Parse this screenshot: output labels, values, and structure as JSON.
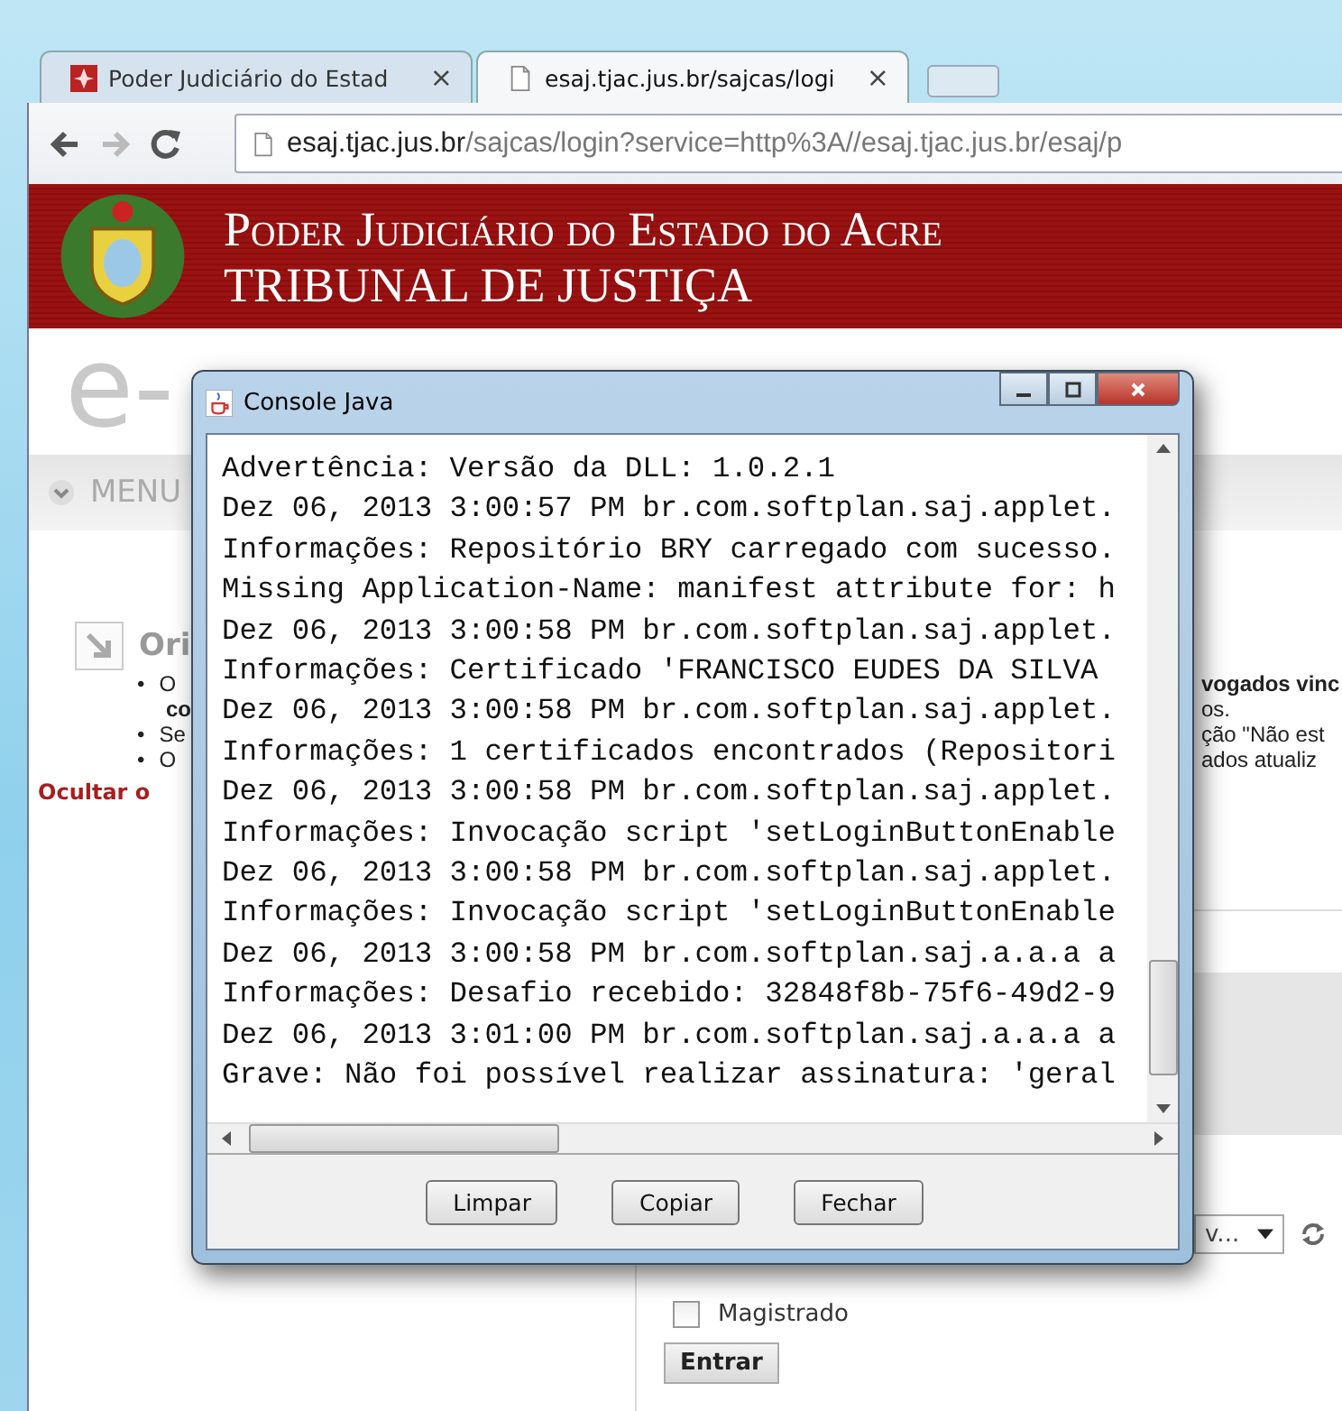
{
  "browser": {
    "tabs": [
      {
        "title": "Poder Judiciário do Estad",
        "close": "×",
        "selected": false
      },
      {
        "title": "esaj.tjac.jus.br/sajcas/logi",
        "close": "×",
        "selected": true
      }
    ],
    "address": {
      "host": "esaj.tjac.jus.br",
      "path": "/sajcas/login?service=http%3A//esaj.tjac.jus.br/esaj/p"
    }
  },
  "page": {
    "banner": {
      "line_1": "Poder Judiciário do Estado do Acre",
      "line_2": "TRIBUNAL DE JUSTIÇA"
    },
    "logo": "e-",
    "menu": "MENU",
    "info": {
      "heading": "Ori",
      "bullets": [
        {
          "bullet": "•",
          "left": "O",
          "right": "vogados vinc"
        },
        {
          "left": "**co**",
          "right": "os."
        },
        {
          "bullet": "•",
          "left": "Se",
          "right": "ção \"Não est"
        },
        {
          "bullet": "•",
          "left": "O",
          "right": "ados atualiz"
        }
      ],
      "hide_link": "Ocultar o"
    },
    "login": {
      "select_value": "v...",
      "checkbox": {
        "label": "Magistrado",
        "checked": false
      },
      "submit": "Entrar"
    }
  },
  "console": {
    "title": "Console Java",
    "lines": [
      "Advertência: Versão da DLL: 1.0.2.1",
      "Dez 06, 2013 3:00:57 PM br.com.softplan.saj.applet.",
      "Informações: Repositório BRY carregado com sucesso.",
      "Missing Application-Name: manifest attribute for: h",
      "Dez 06, 2013 3:00:58 PM br.com.softplan.saj.applet.",
      "Informações: Certificado 'FRANCISCO EUDES DA SILVA",
      "Dez 06, 2013 3:00:58 PM br.com.softplan.saj.applet.",
      "Informações: 1 certificados encontrados (Repositori",
      "Dez 06, 2013 3:00:58 PM br.com.softplan.saj.applet.",
      "Informações: Invocação script 'setLoginButtonEnable",
      "Dez 06, 2013 3:00:58 PM br.com.softplan.saj.applet.",
      "Informações: Invocação script 'setLoginButtonEnable",
      "Dez 06, 2013 3:00:58 PM br.com.softplan.saj.a.a.a a",
      "Informações: Desafio recebido: 32848f8b-75f6-49d2-9",
      "Dez 06, 2013 3:01:00 PM br.com.softplan.saj.a.a.a a",
      "Grave: Não foi possível realizar assinatura: 'geral"
    ],
    "buttons": [
      "Limpar",
      "Copiar",
      "Fechar"
    ]
  }
}
